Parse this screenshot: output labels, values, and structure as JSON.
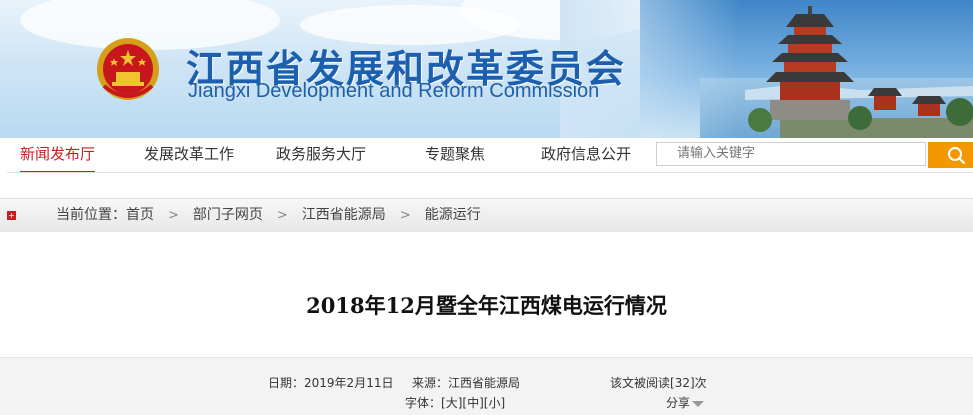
{
  "header": {
    "title_cn": "江西省发展和改革委员会",
    "title_en": "Jiangxi Development and Reform Commission"
  },
  "nav": {
    "items": [
      {
        "label": "新闻发布厅",
        "active": true
      },
      {
        "label": "发展改革工作",
        "active": false
      },
      {
        "label": "政务服务大厅",
        "active": false
      },
      {
        "label": "专题聚焦",
        "active": false
      },
      {
        "label": "政府信息公开",
        "active": false
      }
    ]
  },
  "search": {
    "placeholder": "请输入关键字",
    "button_icon": "search-icon"
  },
  "breadcrumb": {
    "prefix": "当前位置：",
    "items": [
      "首页",
      "部门子网页",
      "江西省能源局",
      "能源运行"
    ],
    "separator": ">"
  },
  "article": {
    "title": "2018年12月暨全年江西煤电运行情况",
    "date_label": "日期：",
    "date": "2019年2月11日",
    "source_label": "来源：",
    "source": "江西省能源局",
    "reads_prefix": "该文被阅读[",
    "reads": "32",
    "reads_suffix": "]次",
    "font_label": "字体：",
    "font_large": "[大]",
    "font_medium": "[中]",
    "font_small": "[小]",
    "share_label": "分享"
  },
  "colors": {
    "accent_red": "#c81e1e",
    "brand_blue": "#1b5fae",
    "search_orange": "#f39800"
  }
}
